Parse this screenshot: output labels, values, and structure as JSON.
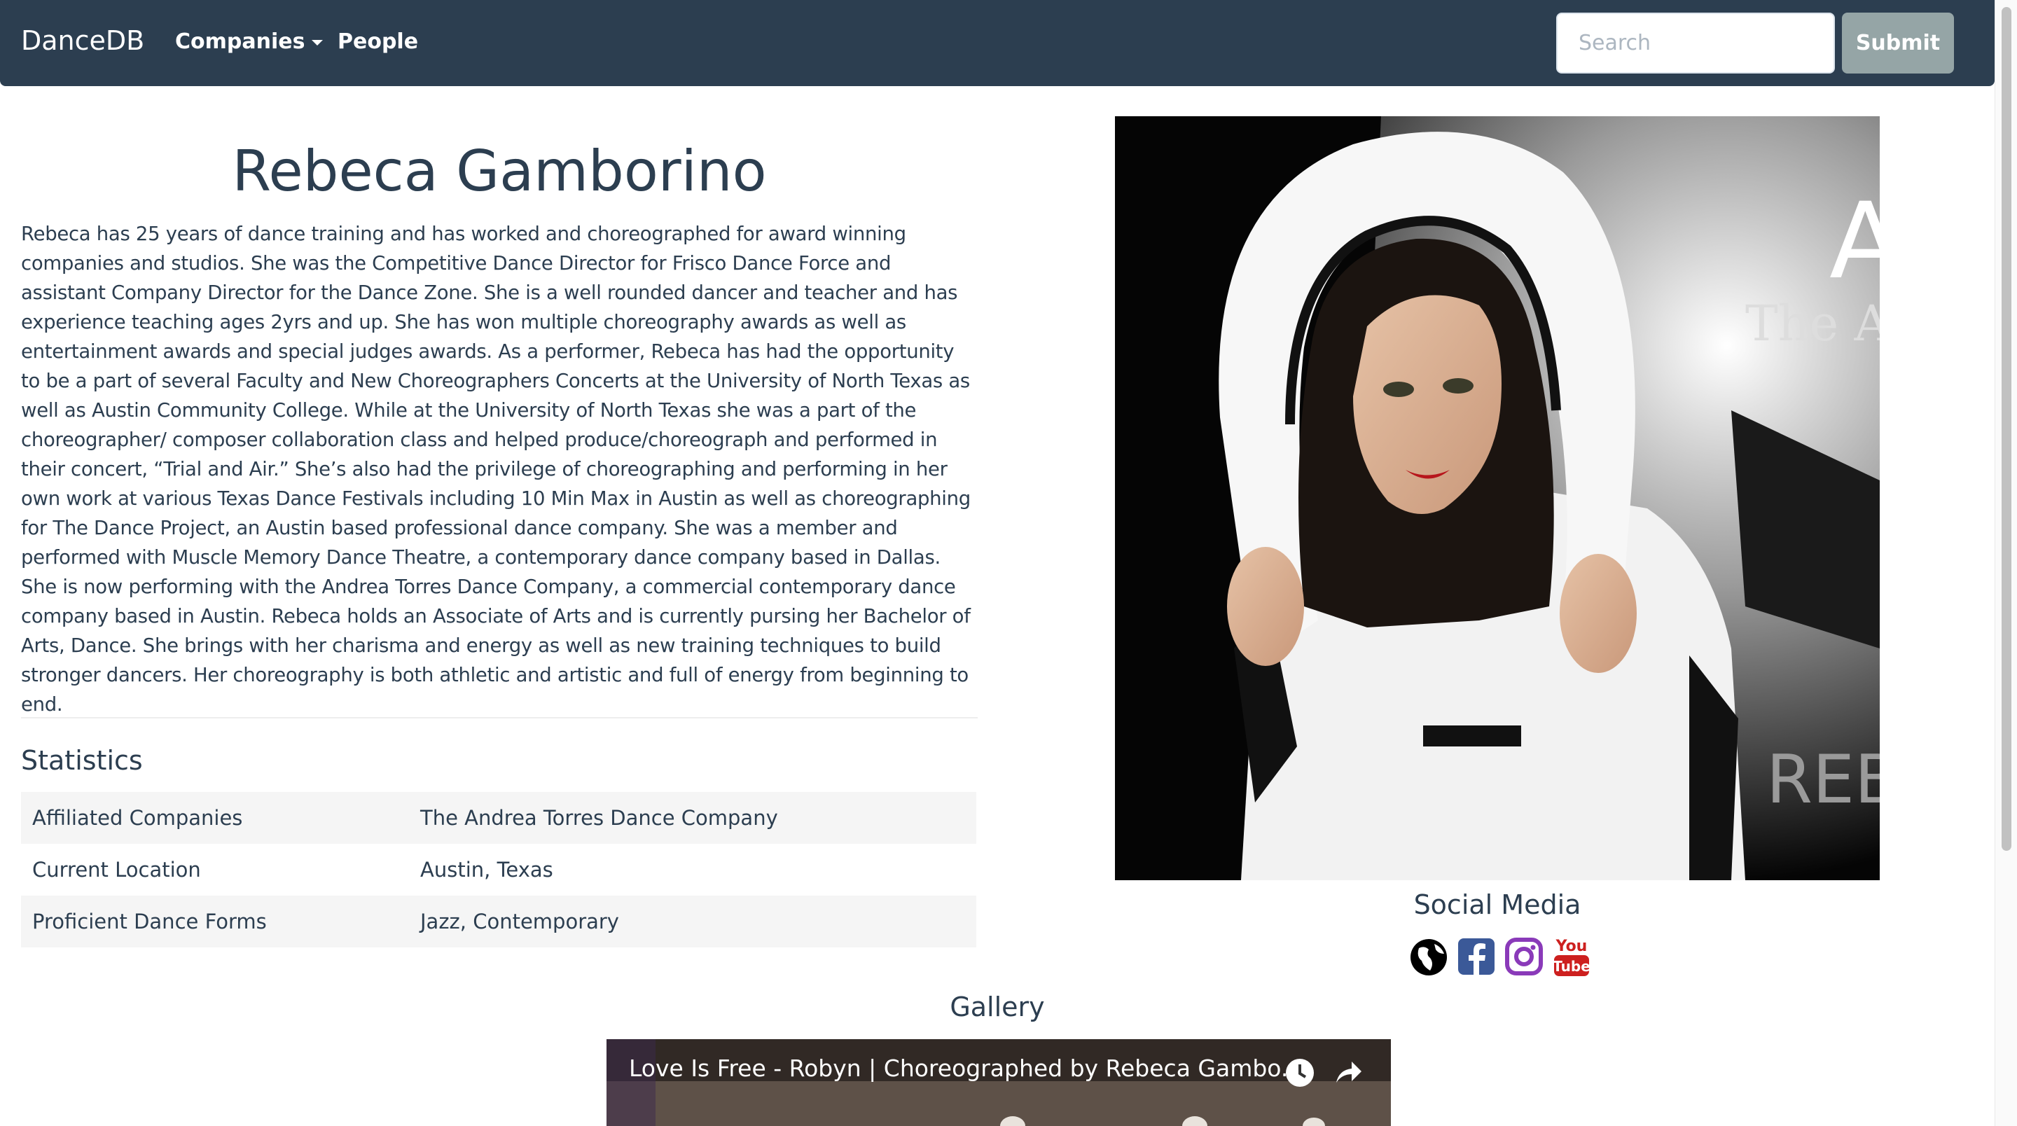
{
  "navbar": {
    "brand": "DanceDB",
    "companies_label": "Companies",
    "people_label": "People",
    "search_placeholder": "Search",
    "submit_label": "Submit"
  },
  "profile": {
    "name": "Rebeca Gamborino",
    "bio": "Rebeca has 25 years of dance training and has worked and choreographed for award winning companies and studios. She was the Competitive Dance Director for Frisco Dance Force and assistant Company Director for the Dance Zone. She is a well rounded dancer and teacher and has experience teaching ages 2yrs and up. She has won multiple choreography awards as well as entertainment awards and special judges awards.  As a performer, Rebeca has had the opportunity to be a part of several Faculty and New Choreographers Concerts at the University of North Texas as well as Austin Community College. While at the University of North Texas she was a part of the choreographer/ composer collaboration class and helped produce/choreograph and performed in their concert, “Trial and Air.” She’s also had the privilege of choreographing and performing in her own work at various Texas Dance Festivals including 10 Min Max in Austin as well as choreographing for The Dance Project, an Austin based professional dance company. She was a member and performed with Muscle Memory Dance Theatre, a contemporary dance company based in Dallas. She is now performing with the Andrea Torres Dance Company, a commercial contemporary dance company based in Austin. Rebeca holds an Associate of Arts and is currently pursing her Bachelor of Arts, Dance. She brings with her charisma and energy as well as new training techniques to build stronger dancers. Her choreography is both athletic and artistic and full of energy from beginning to end."
  },
  "statistics": {
    "heading": "Statistics",
    "rows": [
      {
        "label": "Affiliated Companies",
        "value": "The Andrea Torres Dance Company"
      },
      {
        "label": "Current Location",
        "value": "Austin, Texas"
      },
      {
        "label": "Proficient Dance Forms",
        "value": "Jazz, Contemporary"
      }
    ]
  },
  "photo": {
    "watermark_top": "A",
    "watermark_sub": "The Ar",
    "watermark_bottom": "REBEC"
  },
  "social": {
    "heading": "Social Media",
    "icons": [
      "globe-icon",
      "facebook-icon",
      "instagram-icon",
      "youtube-icon"
    ],
    "youtube_you": "You",
    "youtube_tube": "Tube",
    "colors": {
      "facebook": "#3b5998",
      "instagram": "#8a3ab9",
      "youtube": "#cd201f"
    }
  },
  "gallery": {
    "heading": "Gallery",
    "video_title": "Love Is Free - Robyn | Choreographed by Rebeca Gambo..."
  },
  "colors": {
    "navbar": "#2c3e50",
    "text": "#2c3e50",
    "submit": "#95a5a6",
    "table_stripe": "#f5f5f5"
  }
}
